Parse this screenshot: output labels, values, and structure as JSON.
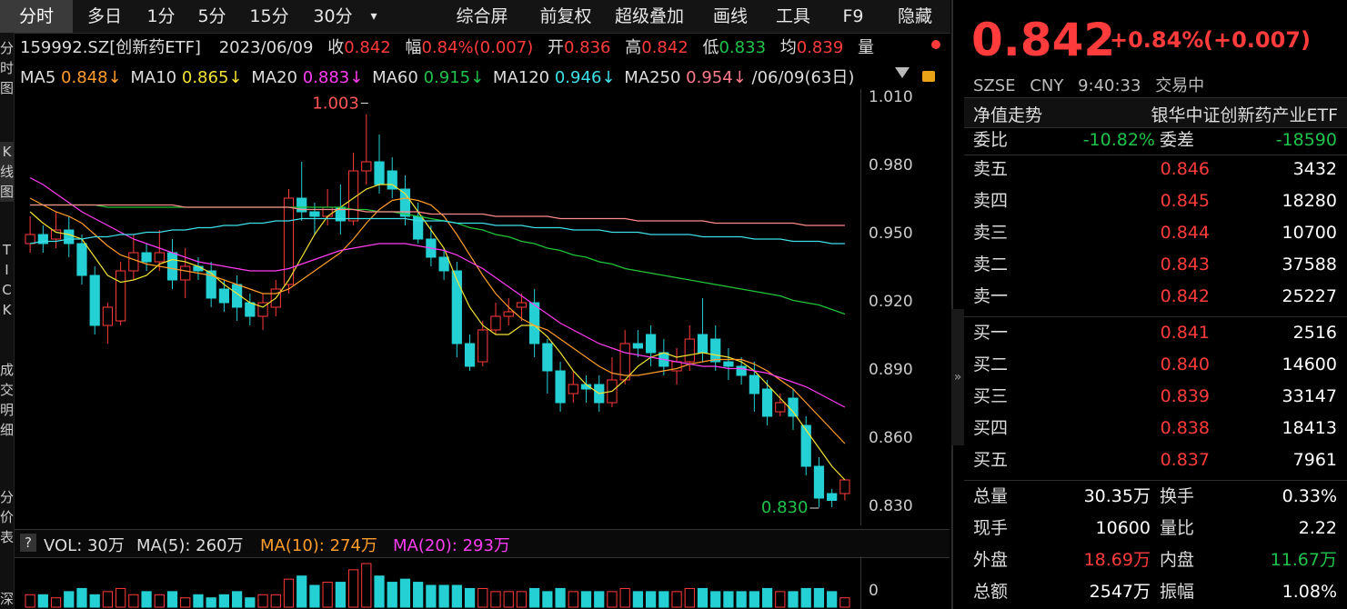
{
  "toolbar": {
    "items": [
      "分时",
      "多日",
      "1分",
      "5分",
      "15分",
      "30分",
      "▾",
      "综合屏",
      "前复权",
      "超级叠加",
      "画线",
      "工具",
      "F9",
      "隐藏"
    ]
  },
  "left_tabs": [
    "分时图",
    "K线图",
    "TICK",
    "成交明细",
    "分价表",
    "深"
  ],
  "info": {
    "code": "159992.SZ[创新药ETF]",
    "date": "2023/06/09",
    "close_label": "收",
    "close": "0.842",
    "amp_label": "幅",
    "amp": "0.84%(0.007)",
    "open_label": "开",
    "open": "0.836",
    "high_label": "高",
    "high": "0.842",
    "low_label": "低",
    "low": "0.833",
    "avg_label": "均",
    "avg": "0.839",
    "vol_label": "量"
  },
  "ma_row": {
    "ma5_label": "MA5",
    "ma5": "0.848↓",
    "ma10_label": "MA10",
    "ma10": "0.865↓",
    "ma20_label": "MA20",
    "ma20": "0.883↓",
    "ma60_label": "MA60",
    "ma60": "0.915↓",
    "ma120_label": "MA120",
    "ma120": "0.946↓",
    "ma250_label": "MA250",
    "ma250": "0.954↓",
    "range": "/06/09(63日)"
  },
  "chart_data": {
    "type": "candlestick",
    "ylim": [
      0.822,
      1.014
    ],
    "y_ticks": [
      "1.010",
      "0.980",
      "0.950",
      "0.920",
      "0.890",
      "0.860",
      "0.830"
    ],
    "max_label": "1.003",
    "min_label": "0.830",
    "candles": [
      [
        0.946,
        0.95,
        0.958,
        0.942
      ],
      [
        0.95,
        0.946,
        0.954,
        0.942
      ],
      [
        0.948,
        0.952,
        0.96,
        0.944
      ],
      [
        0.952,
        0.946,
        0.958,
        0.94
      ],
      [
        0.946,
        0.932,
        0.95,
        0.928
      ],
      [
        0.932,
        0.91,
        0.936,
        0.906
      ],
      [
        0.91,
        0.918,
        0.92,
        0.902
      ],
      [
        0.912,
        0.934,
        0.938,
        0.91
      ],
      [
        0.934,
        0.942,
        0.95,
        0.93
      ],
      [
        0.942,
        0.938,
        0.946,
        0.934
      ],
      [
        0.938,
        0.942,
        0.952,
        0.934
      ],
      [
        0.942,
        0.93,
        0.948,
        0.926
      ],
      [
        0.93,
        0.936,
        0.944,
        0.922
      ],
      [
        0.936,
        0.934,
        0.94,
        0.93
      ],
      [
        0.934,
        0.922,
        0.938,
        0.918
      ],
      [
        0.926,
        0.92,
        0.93,
        0.916
      ],
      [
        0.928,
        0.918,
        0.932,
        0.912
      ],
      [
        0.92,
        0.914,
        0.924,
        0.91
      ],
      [
        0.914,
        0.92,
        0.924,
        0.908
      ],
      [
        0.918,
        0.926,
        0.93,
        0.914
      ],
      [
        0.928,
        0.966,
        0.97,
        0.924
      ],
      [
        0.966,
        0.96,
        0.982,
        0.956
      ],
      [
        0.96,
        0.958,
        0.964,
        0.95
      ],
      [
        0.958,
        0.962,
        0.97,
        0.954
      ],
      [
        0.962,
        0.956,
        0.972,
        0.95
      ],
      [
        0.956,
        0.978,
        0.986,
        0.954
      ],
      [
        0.978,
        0.982,
        1.003,
        0.972
      ],
      [
        0.982,
        0.972,
        0.994,
        0.968
      ],
      [
        0.978,
        0.97,
        0.984,
        0.966
      ],
      [
        0.97,
        0.958,
        0.976,
        0.954
      ],
      [
        0.958,
        0.948,
        0.964,
        0.946
      ],
      [
        0.948,
        0.94,
        0.954,
        0.936
      ],
      [
        0.94,
        0.934,
        0.944,
        0.93
      ],
      [
        0.934,
        0.902,
        0.938,
        0.896
      ],
      [
        0.902,
        0.892,
        0.906,
        0.89
      ],
      [
        0.894,
        0.908,
        0.912,
        0.892
      ],
      [
        0.908,
        0.914,
        0.92,
        0.906
      ],
      [
        0.914,
        0.916,
        0.922,
        0.91
      ],
      [
        0.918,
        0.92,
        0.924,
        0.912
      ],
      [
        0.92,
        0.902,
        0.926,
        0.896
      ],
      [
        0.902,
        0.89,
        0.904,
        0.88
      ],
      [
        0.89,
        0.876,
        0.894,
        0.872
      ],
      [
        0.88,
        0.884,
        0.89,
        0.876
      ],
      [
        0.884,
        0.882,
        0.888,
        0.876
      ],
      [
        0.884,
        0.876,
        0.888,
        0.872
      ],
      [
        0.876,
        0.886,
        0.896,
        0.874
      ],
      [
        0.886,
        0.902,
        0.908,
        0.884
      ],
      [
        0.902,
        0.9,
        0.908,
        0.896
      ],
      [
        0.906,
        0.898,
        0.91,
        0.892
      ],
      [
        0.898,
        0.892,
        0.904,
        0.888
      ],
      [
        0.89,
        0.894,
        0.9,
        0.884
      ],
      [
        0.894,
        0.904,
        0.91,
        0.89
      ],
      [
        0.906,
        0.898,
        0.922,
        0.894
      ],
      [
        0.904,
        0.894,
        0.91,
        0.89
      ],
      [
        0.894,
        0.892,
        0.9,
        0.886
      ],
      [
        0.892,
        0.888,
        0.896,
        0.884
      ],
      [
        0.888,
        0.88,
        0.894,
        0.872
      ],
      [
        0.882,
        0.87,
        0.886,
        0.866
      ],
      [
        0.872,
        0.876,
        0.88,
        0.87
      ],
      [
        0.878,
        0.87,
        0.882,
        0.864
      ],
      [
        0.866,
        0.848,
        0.87,
        0.844
      ],
      [
        0.848,
        0.834,
        0.852,
        0.83
      ],
      [
        0.836,
        0.833,
        0.838,
        0.83
      ],
      [
        0.836,
        0.842,
        0.842,
        0.833
      ]
    ],
    "ma": [
      {
        "name": "MA5",
        "color": "#f2e234",
        "values": [
          0.96,
          0.955,
          0.951,
          0.95,
          0.948,
          0.94,
          0.932,
          0.929,
          0.93,
          0.932,
          0.937,
          0.939,
          0.938,
          0.936,
          0.933,
          0.928,
          0.924,
          0.92,
          0.918,
          0.922,
          0.93,
          0.94,
          0.95,
          0.958,
          0.962,
          0.966,
          0.97,
          0.972,
          0.972,
          0.968,
          0.96,
          0.952,
          0.944,
          0.93,
          0.918,
          0.91,
          0.906,
          0.906,
          0.91,
          0.91,
          0.905,
          0.898,
          0.89,
          0.884,
          0.88,
          0.881,
          0.886,
          0.892,
          0.896,
          0.898,
          0.896,
          0.897,
          0.898,
          0.897,
          0.896,
          0.894,
          0.89,
          0.884,
          0.878,
          0.872,
          0.864,
          0.856,
          0.848,
          0.842
        ]
      },
      {
        "name": "MA10",
        "color": "#ff9d2b",
        "values": [
          0.966,
          0.963,
          0.96,
          0.958,
          0.955,
          0.95,
          0.945,
          0.941,
          0.939,
          0.937,
          0.936,
          0.935,
          0.934,
          0.933,
          0.932,
          0.93,
          0.928,
          0.926,
          0.924,
          0.924,
          0.926,
          0.93,
          0.934,
          0.938,
          0.942,
          0.948,
          0.955,
          0.961,
          0.965,
          0.966,
          0.965,
          0.963,
          0.958,
          0.95,
          0.941,
          0.932,
          0.924,
          0.918,
          0.913,
          0.91,
          0.908,
          0.904,
          0.9,
          0.896,
          0.892,
          0.889,
          0.888,
          0.888,
          0.889,
          0.89,
          0.891,
          0.893,
          0.894,
          0.895,
          0.895,
          0.895,
          0.893,
          0.89,
          0.886,
          0.882,
          0.876,
          0.87,
          0.864,
          0.858
        ]
      },
      {
        "name": "MA20",
        "color": "#ff3df2",
        "values": [
          0.975,
          0.972,
          0.968,
          0.964,
          0.96,
          0.957,
          0.954,
          0.951,
          0.948,
          0.946,
          0.944,
          0.942,
          0.94,
          0.938,
          0.937,
          0.936,
          0.935,
          0.934,
          0.934,
          0.934,
          0.935,
          0.937,
          0.939,
          0.941,
          0.943,
          0.944,
          0.945,
          0.946,
          0.946,
          0.946,
          0.945,
          0.944,
          0.943,
          0.941,
          0.938,
          0.935,
          0.931,
          0.927,
          0.923,
          0.919,
          0.915,
          0.911,
          0.908,
          0.905,
          0.902,
          0.9,
          0.898,
          0.897,
          0.896,
          0.895,
          0.894,
          0.893,
          0.892,
          0.892,
          0.891,
          0.891,
          0.89,
          0.889,
          0.887,
          0.885,
          0.883,
          0.88,
          0.877,
          0.874
        ]
      },
      {
        "name": "MA60",
        "color": "#22c43a",
        "values": [
          0.963,
          0.963,
          0.963,
          0.963,
          0.963,
          0.963,
          0.962,
          0.962,
          0.962,
          0.962,
          0.962,
          0.962,
          0.962,
          0.962,
          0.962,
          0.962,
          0.962,
          0.962,
          0.962,
          0.962,
          0.962,
          0.962,
          0.962,
          0.962,
          0.962,
          0.961,
          0.961,
          0.96,
          0.96,
          0.959,
          0.958,
          0.957,
          0.956,
          0.955,
          0.953,
          0.952,
          0.95,
          0.949,
          0.947,
          0.946,
          0.944,
          0.943,
          0.941,
          0.94,
          0.938,
          0.937,
          0.935,
          0.934,
          0.933,
          0.932,
          0.931,
          0.93,
          0.929,
          0.928,
          0.927,
          0.926,
          0.925,
          0.924,
          0.923,
          0.921,
          0.92,
          0.919,
          0.917,
          0.915
        ]
      },
      {
        "name": "MA120",
        "color": "#3ee0e8",
        "values": [
          0.946,
          0.947,
          0.947,
          0.948,
          0.948,
          0.949,
          0.949,
          0.95,
          0.95,
          0.951,
          0.951,
          0.952,
          0.952,
          0.953,
          0.953,
          0.954,
          0.954,
          0.955,
          0.955,
          0.956,
          0.956,
          0.957,
          0.957,
          0.957,
          0.957,
          0.957,
          0.957,
          0.957,
          0.957,
          0.957,
          0.956,
          0.956,
          0.956,
          0.955,
          0.955,
          0.955,
          0.954,
          0.954,
          0.954,
          0.953,
          0.953,
          0.953,
          0.952,
          0.952,
          0.952,
          0.951,
          0.951,
          0.951,
          0.95,
          0.95,
          0.95,
          0.95,
          0.949,
          0.949,
          0.949,
          0.949,
          0.948,
          0.948,
          0.948,
          0.947,
          0.947,
          0.947,
          0.946,
          0.946
        ]
      },
      {
        "name": "MA250",
        "color": "#ff8a8a",
        "values": [
          0.963,
          0.963,
          0.963,
          0.963,
          0.963,
          0.963,
          0.963,
          0.963,
          0.963,
          0.963,
          0.963,
          0.963,
          0.962,
          0.962,
          0.962,
          0.962,
          0.962,
          0.962,
          0.962,
          0.962,
          0.962,
          0.961,
          0.961,
          0.961,
          0.961,
          0.961,
          0.96,
          0.96,
          0.96,
          0.96,
          0.96,
          0.959,
          0.959,
          0.959,
          0.959,
          0.959,
          0.958,
          0.958,
          0.958,
          0.958,
          0.958,
          0.957,
          0.957,
          0.957,
          0.957,
          0.957,
          0.957,
          0.956,
          0.956,
          0.956,
          0.956,
          0.956,
          0.956,
          0.955,
          0.955,
          0.955,
          0.955,
          0.955,
          0.955,
          0.955,
          0.954,
          0.954,
          0.954,
          0.954
        ]
      }
    ],
    "volume": [
      4,
      4,
      3,
      5,
      6,
      4,
      5,
      6,
      4,
      5,
      4,
      5,
      3,
      4,
      3,
      4,
      5,
      3,
      4,
      4,
      9,
      10,
      7,
      8,
      8,
      12,
      14,
      10,
      8,
      9,
      8,
      7,
      7,
      7,
      6,
      6,
      5,
      5,
      5,
      6,
      5,
      6,
      5,
      5,
      5,
      5,
      6,
      5,
      5,
      5,
      5,
      6,
      6,
      5,
      5,
      5,
      5,
      6,
      5,
      5,
      6,
      6,
      5,
      3
    ]
  },
  "volume_info": {
    "help": "?",
    "vol": "VOL: 30万",
    "ma5": "MA(5): 260万",
    "ma10": "MA(10): 274万",
    "ma20": "MA(20): 293万",
    "axis_zero": "0"
  },
  "quote": {
    "price": "0.842",
    "change_pct": "+0.84%",
    "change": "(+0.007)",
    "exchange": "SZSE",
    "currency": "CNY",
    "time": "9:40:33",
    "status": "交易中",
    "nav_label": "净值走势",
    "fund_name": "银华中证创新药产业ETF",
    "wb_label": "委比",
    "wb": "-10.82%",
    "wc_label": "委差",
    "wc": "-18590",
    "asks": [
      {
        "label": "卖五",
        "price": "0.846",
        "vol": "3432"
      },
      {
        "label": "卖四",
        "price": "0.845",
        "vol": "18280"
      },
      {
        "label": "卖三",
        "price": "0.844",
        "vol": "10700"
      },
      {
        "label": "卖二",
        "price": "0.843",
        "vol": "37588"
      },
      {
        "label": "卖一",
        "price": "0.842",
        "vol": "25227"
      }
    ],
    "bids": [
      {
        "label": "买一",
        "price": "0.841",
        "vol": "2516"
      },
      {
        "label": "买二",
        "price": "0.840",
        "vol": "14600"
      },
      {
        "label": "买三",
        "price": "0.839",
        "vol": "33147"
      },
      {
        "label": "买四",
        "price": "0.838",
        "vol": "18413"
      },
      {
        "label": "买五",
        "price": "0.837",
        "vol": "7961"
      }
    ],
    "stats": [
      {
        "a": "总量",
        "b": "30.35万",
        "c": "换手",
        "d": "0.33%",
        "bc": "white",
        "dc": "white"
      },
      {
        "a": "现手",
        "b": "10600",
        "c": "量比",
        "d": "2.22",
        "bc": "white",
        "dc": "white"
      },
      {
        "a": "外盘",
        "b": "18.69万",
        "c": "内盘",
        "d": "11.67万",
        "bc": "red",
        "dc": "green"
      },
      {
        "a": "总额",
        "b": "2547万",
        "c": "振幅",
        "d": "1.08%",
        "bc": "white",
        "dc": "white"
      }
    ],
    "collapse_icon": "»"
  },
  "colors": {
    "up": "#ff3b3b",
    "down": "#25d0d4",
    "bg": "#000000"
  }
}
